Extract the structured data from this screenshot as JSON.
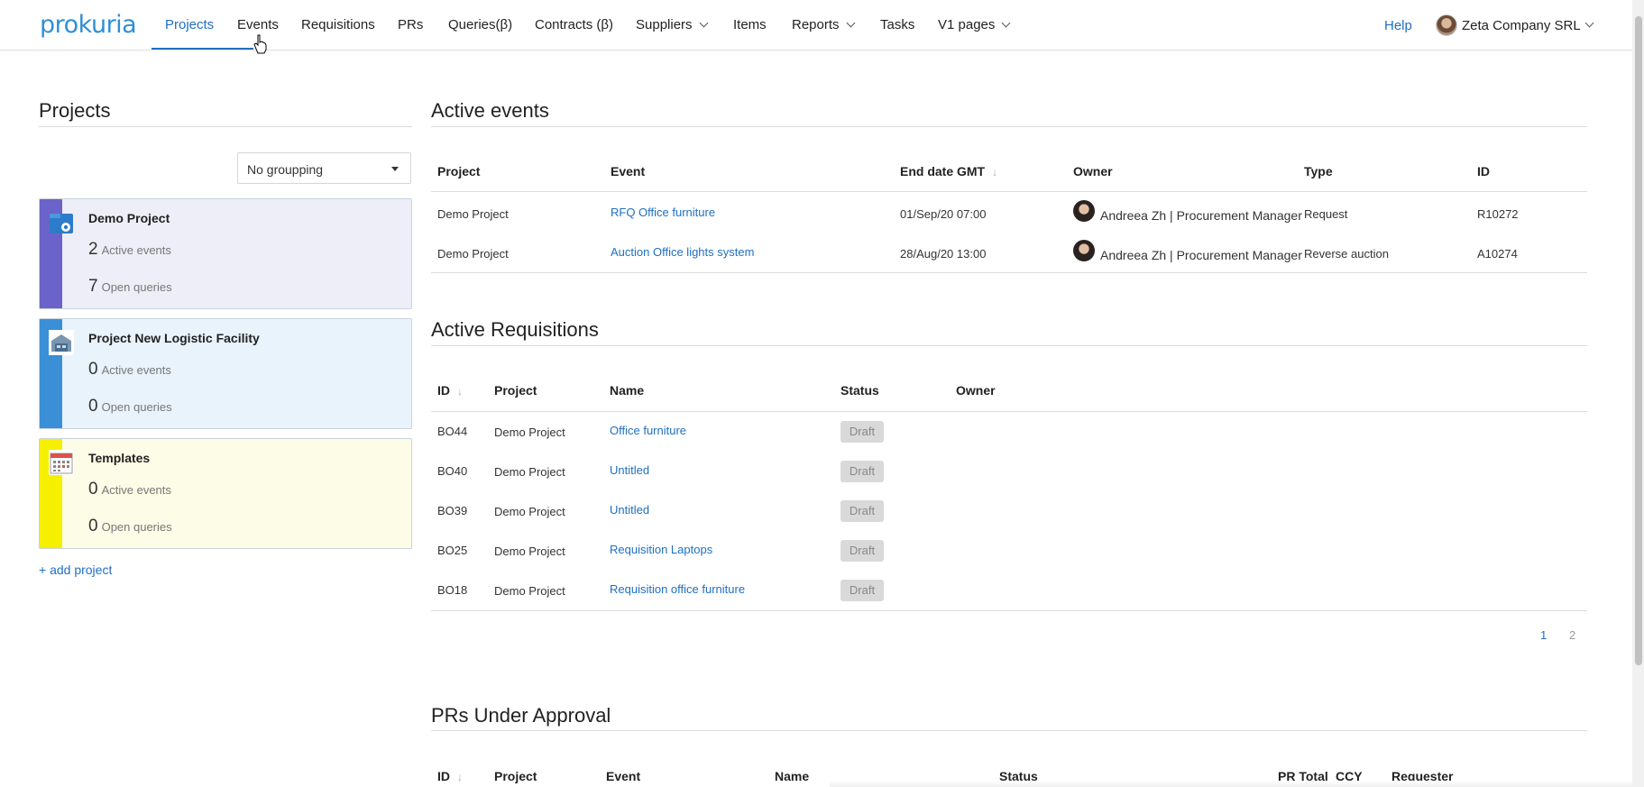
{
  "nav": {
    "logo": "prokuria",
    "items": [
      {
        "label": "Projects",
        "active": true
      },
      {
        "label": "Events",
        "active": false
      },
      {
        "label": "Requisitions",
        "active": false
      },
      {
        "label": "PRs",
        "active": false
      },
      {
        "label": "Queries(β)",
        "active": false
      },
      {
        "label": "Contracts (β)",
        "active": false
      },
      {
        "label": "Suppliers",
        "active": false,
        "dropdown": true
      },
      {
        "label": "Items",
        "active": false
      },
      {
        "label": "Reports",
        "active": false,
        "dropdown": true
      },
      {
        "label": "Tasks",
        "active": false
      },
      {
        "label": "V1 pages",
        "active": false,
        "dropdown": true
      }
    ],
    "help": "Help",
    "company": "Zeta Company SRL"
  },
  "projects": {
    "title": "Projects",
    "grouping": "No groupping",
    "cards": [
      {
        "name": "Demo Project",
        "active_events": "2",
        "open_queries": "7",
        "stripe_color": "#6b63c9",
        "bg_color": "#eeeef8",
        "icon": "folder-gear-icon"
      },
      {
        "name": "Project New Logistic Facility",
        "active_events": "0",
        "open_queries": "0",
        "stripe_color": "#3b8fd6",
        "bg_color": "#e9f3fc",
        "icon": "warehouse-icon"
      },
      {
        "name": "Templates",
        "active_events": "0",
        "open_queries": "0",
        "stripe_color": "#f5f000",
        "bg_color": "#fdfce6",
        "icon": "calendar-icon"
      }
    ],
    "active_events_label": "Active events",
    "open_queries_label": "Open queries",
    "add_project": "+ add project"
  },
  "active_events": {
    "title": "Active events",
    "headers": [
      "Project",
      "Event",
      "End date GMT",
      "Owner",
      "Type",
      "ID"
    ],
    "rows": [
      {
        "project": "Demo Project",
        "event": "RFQ Office furniture",
        "end_date": "01/Sep/20 07:00",
        "owner": "Andreea Zh | Procurement Manager",
        "type": "Request",
        "id": "R10272"
      },
      {
        "project": "Demo Project",
        "event": "Auction Office lights system",
        "end_date": "28/Aug/20 13:00",
        "owner": "Andreea Zh | Procurement Manager",
        "type": "Reverse auction",
        "id": "A10274"
      }
    ]
  },
  "active_requisitions": {
    "title": "Active Requisitions",
    "headers": [
      "ID",
      "Project",
      "Name",
      "Status",
      "Owner"
    ],
    "rows": [
      {
        "id": "BO44",
        "project": "Demo Project",
        "name": "Office furniture",
        "status": "Draft"
      },
      {
        "id": "BO40",
        "project": "Demo Project",
        "name": "Untitled",
        "status": "Draft"
      },
      {
        "id": "BO39",
        "project": "Demo Project",
        "name": "Untitled",
        "status": "Draft"
      },
      {
        "id": "BO25",
        "project": "Demo Project",
        "name": "Requisition Laptops",
        "status": "Draft"
      },
      {
        "id": "BO18",
        "project": "Demo Project",
        "name": "Requisition office furniture",
        "status": "Draft"
      }
    ],
    "pages": [
      "1",
      "2"
    ],
    "current_page": "1"
  },
  "prs_under_approval": {
    "title": "PRs Under Approval",
    "headers": [
      "ID",
      "Project",
      "Event",
      "Name",
      "Status",
      "PR Total",
      "CCY",
      "Requester"
    ]
  },
  "colors": {
    "accent": "#1f6fc1",
    "badge_bg": "#d9d9d9"
  }
}
